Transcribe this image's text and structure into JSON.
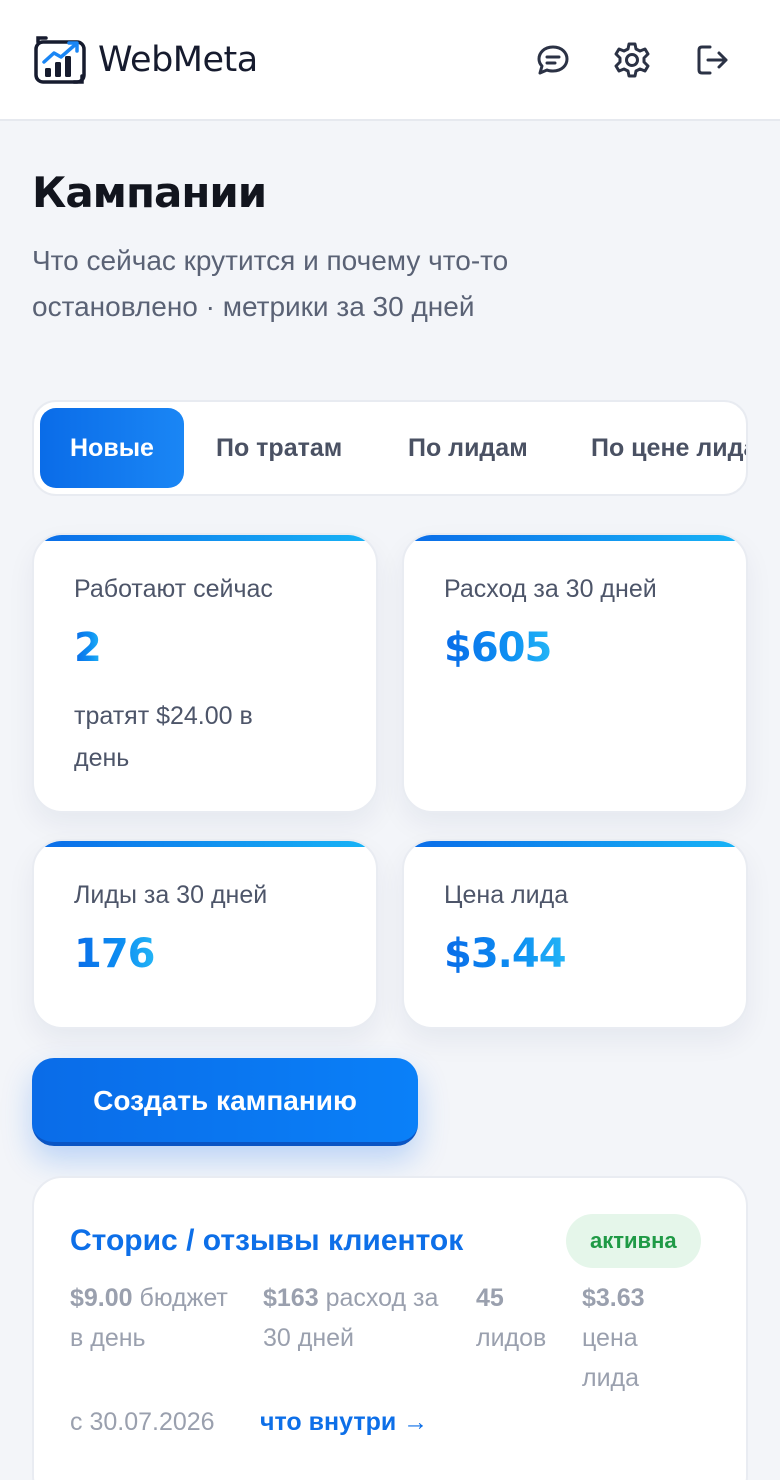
{
  "header": {
    "logo_text": "WebMeta",
    "icons": [
      "chat-icon",
      "gear-icon",
      "logout-icon"
    ]
  },
  "page": {
    "title": "Кампании",
    "subtitle": "Что сейчас крутится и почему что-то остановлено · метрики за 30 дней"
  },
  "tabs": [
    {
      "label": "Новые",
      "active": true
    },
    {
      "label": "По тратам",
      "active": false
    },
    {
      "label": "По лидам",
      "active": false
    },
    {
      "label": "По цене лида",
      "active": false
    }
  ],
  "stats": [
    {
      "label": "Работают сейчас",
      "value": "2",
      "note": "тратят $24.00 в день"
    },
    {
      "label": "Расход за 30 дней",
      "value": "$605",
      "note": ""
    },
    {
      "label": "Лиды за 30 дней",
      "value": "176",
      "note": ""
    },
    {
      "label": "Цена лида",
      "value": "$3.44",
      "note": ""
    }
  ],
  "create_button": "Создать кампанию",
  "campaign": {
    "title": "Сторис / отзывы клиенток",
    "status": "активна",
    "metrics": [
      {
        "value": "$9.00",
        "label": "бюджет в день"
      },
      {
        "value": "$163",
        "label": "расход за 30 дней"
      },
      {
        "value": "45",
        "label": "лидов"
      },
      {
        "value": "$3.63",
        "label": "цена лида"
      }
    ],
    "since": "с 30.07.2026",
    "details_link": "что внутри →"
  },
  "colors": {
    "accent": "#0a6ce8",
    "badge_bg": "#e5f6ea",
    "badge_text": "#1f9a46",
    "background": "#f3f5f9"
  }
}
